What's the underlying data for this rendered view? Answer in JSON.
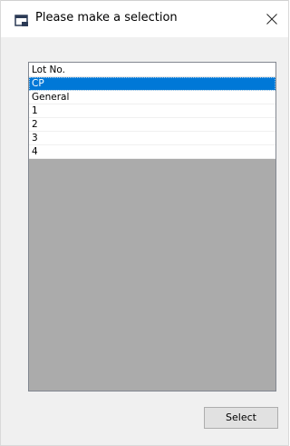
{
  "window": {
    "title": "Please make a selection",
    "close_icon": "close-icon",
    "app_icon": "window-app-icon"
  },
  "list": {
    "column_header": "Lot No.",
    "items": [
      "CP",
      "General",
      "1",
      "2",
      "3",
      "4"
    ],
    "selected_index": 0,
    "selection_color": "#0078d7"
  },
  "buttons": {
    "select_label": "Select"
  }
}
